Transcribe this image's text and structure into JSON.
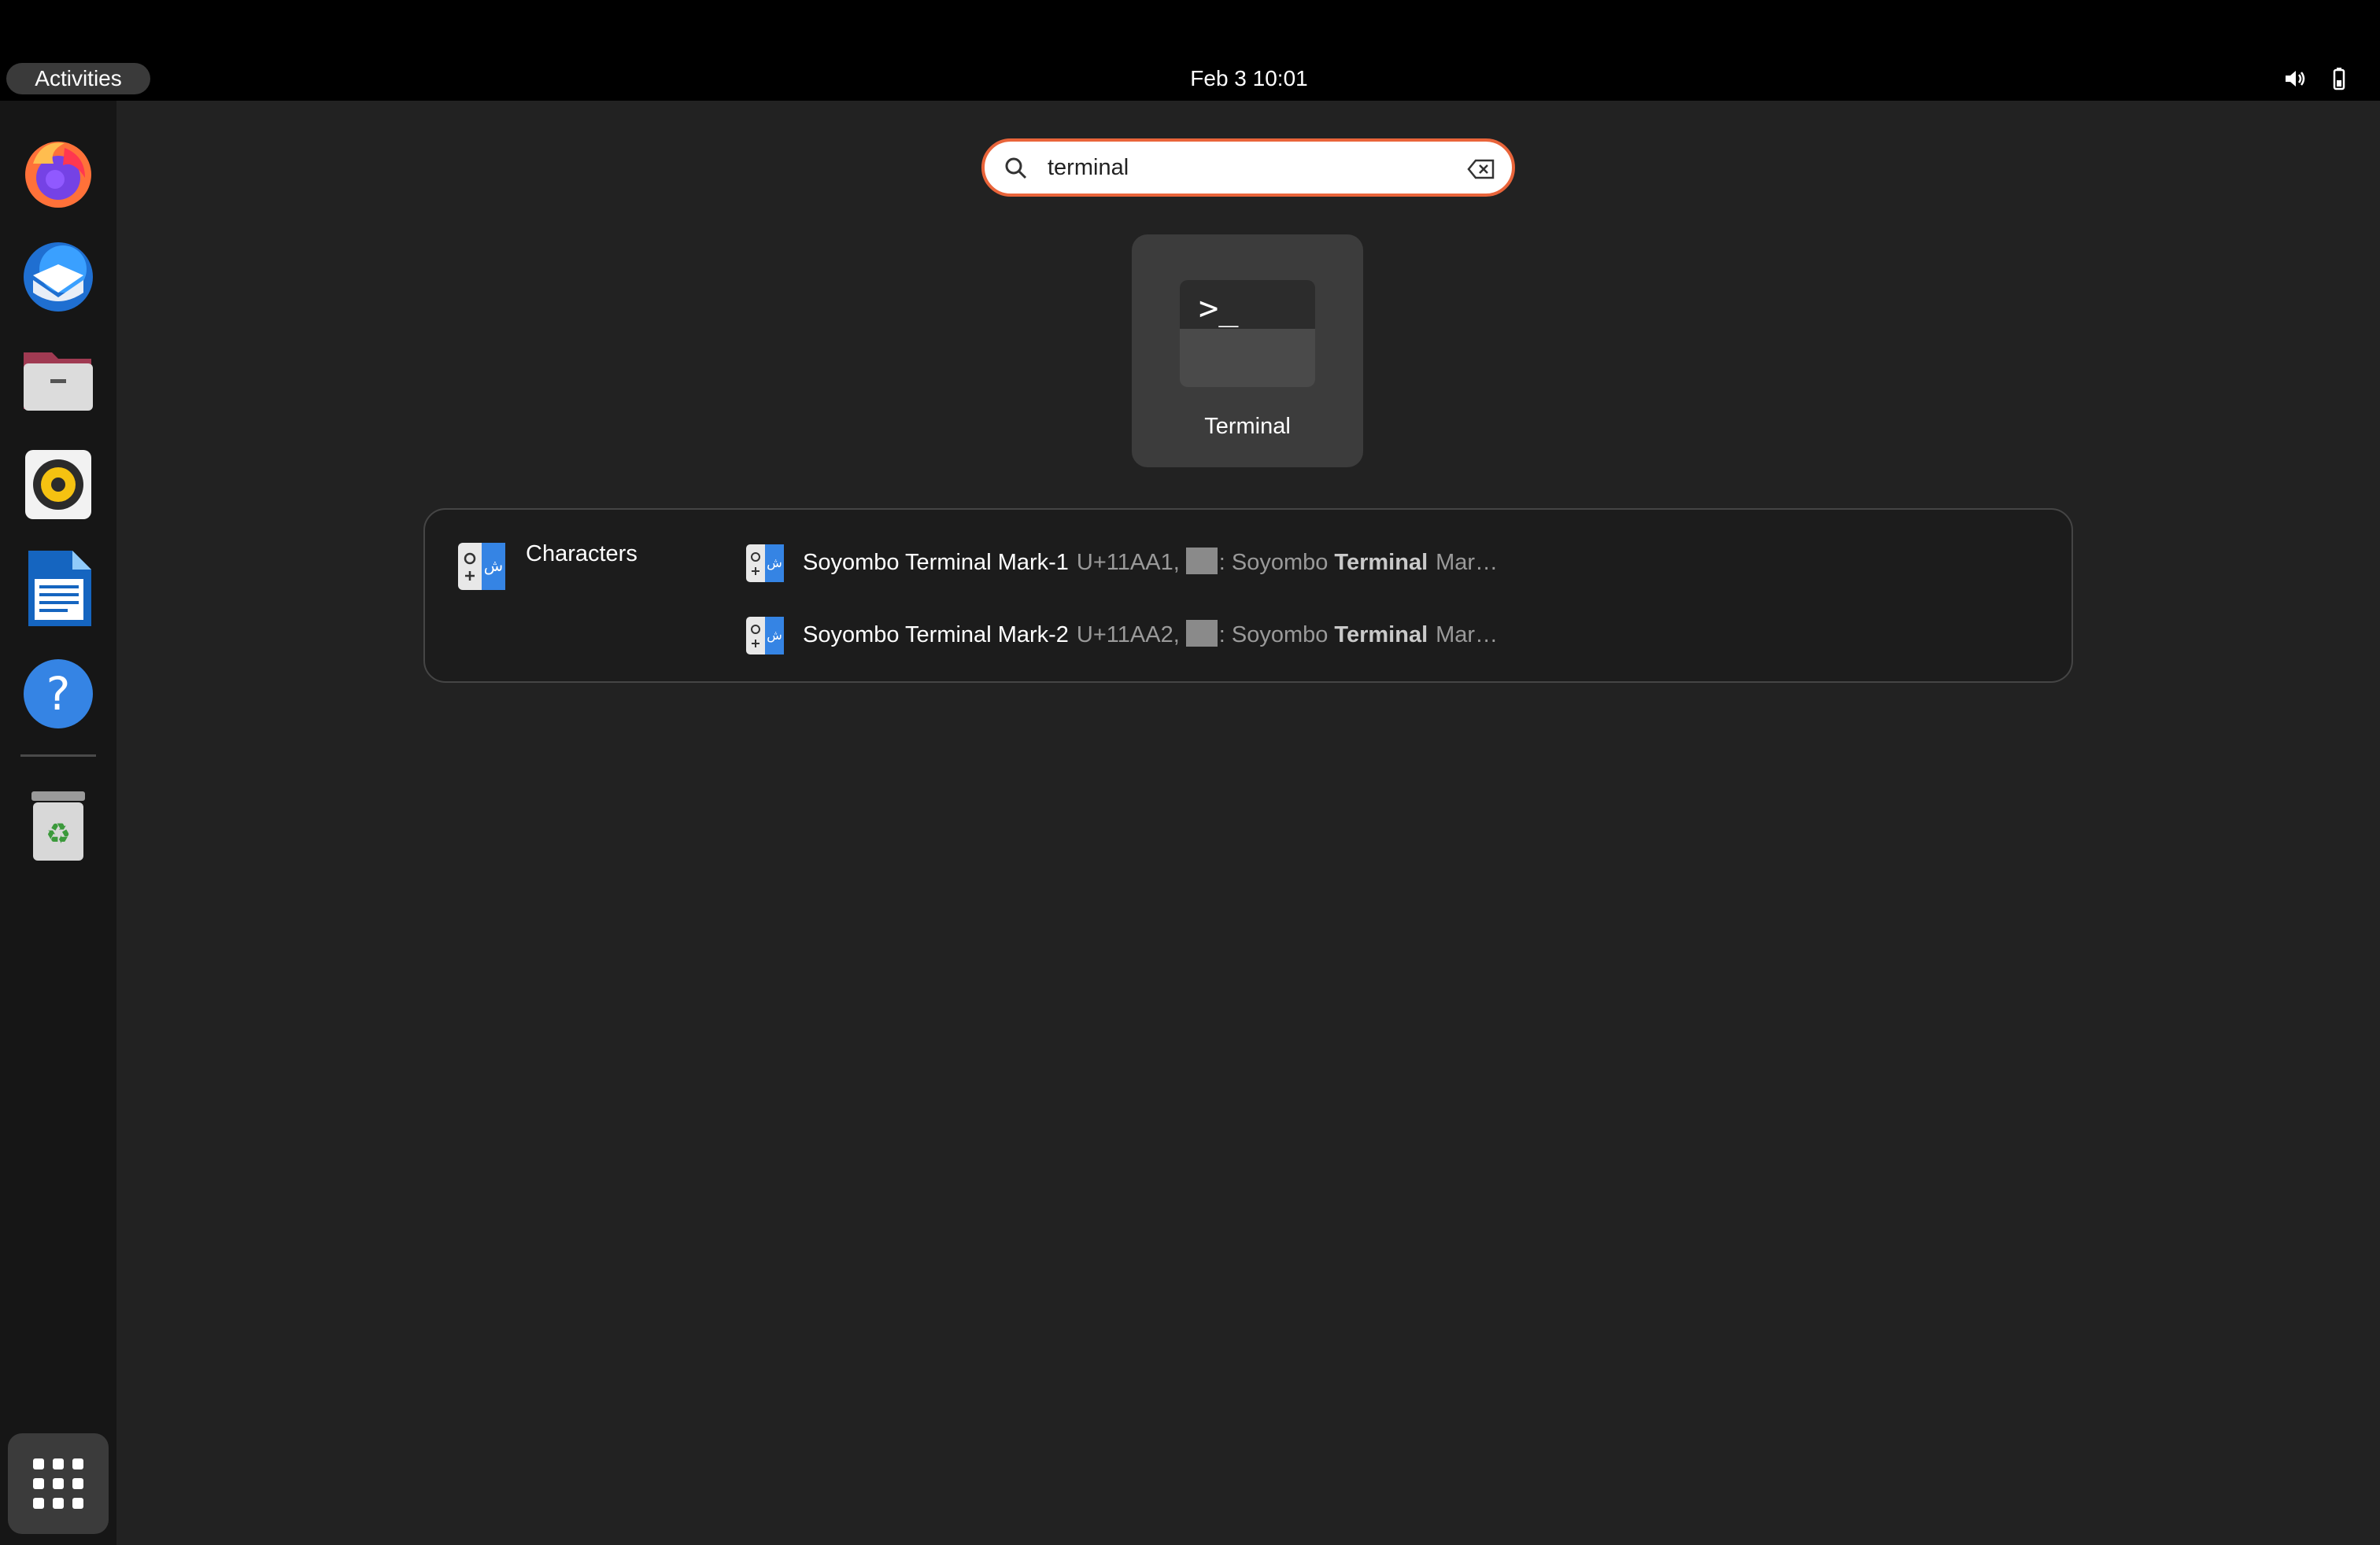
{
  "topbar": {
    "activities_label": "Activities",
    "clock_text": "Feb 3  10:01",
    "volume_icon": "speaker-icon",
    "battery_icon": "battery-icon"
  },
  "dock": {
    "items": [
      {
        "name": "Firefox",
        "icon": "firefox-icon"
      },
      {
        "name": "Thunderbird",
        "icon": "thunderbird-icon"
      },
      {
        "name": "Files",
        "icon": "files-icon"
      },
      {
        "name": "Rhythmbox",
        "icon": "rhythmbox-icon"
      },
      {
        "name": "LibreOffice Writer",
        "icon": "writer-icon"
      },
      {
        "name": "Help",
        "icon": "help-icon"
      },
      {
        "name": "Trash",
        "icon": "trash-icon"
      }
    ],
    "show_apps_icon": "grid-icon"
  },
  "search": {
    "value": "terminal",
    "search_icon": "search-icon",
    "clear_icon": "clear-icon"
  },
  "app_result": {
    "label": "Terminal",
    "icon": "terminal-icon",
    "icon_text": ">_"
  },
  "provider": {
    "label": "Characters",
    "icon": "characters-icon",
    "results": [
      {
        "title": "Soyombo Terminal Mark-1",
        "code": "U+11AA1,",
        "desc_prefix": ": Soyombo",
        "desc_highlight": "Terminal",
        "desc_suffix": "Mar…"
      },
      {
        "title": "Soyombo Terminal Mark-2",
        "code": "U+11AA2,",
        "desc_prefix": ": Soyombo",
        "desc_highlight": "Terminal",
        "desc_suffix": "Mar…"
      }
    ]
  },
  "colors": {
    "background": "#222222",
    "topbar": "#000000",
    "dock": "#161616",
    "accent": "#e9643a",
    "tile": "#3c3c3c"
  }
}
